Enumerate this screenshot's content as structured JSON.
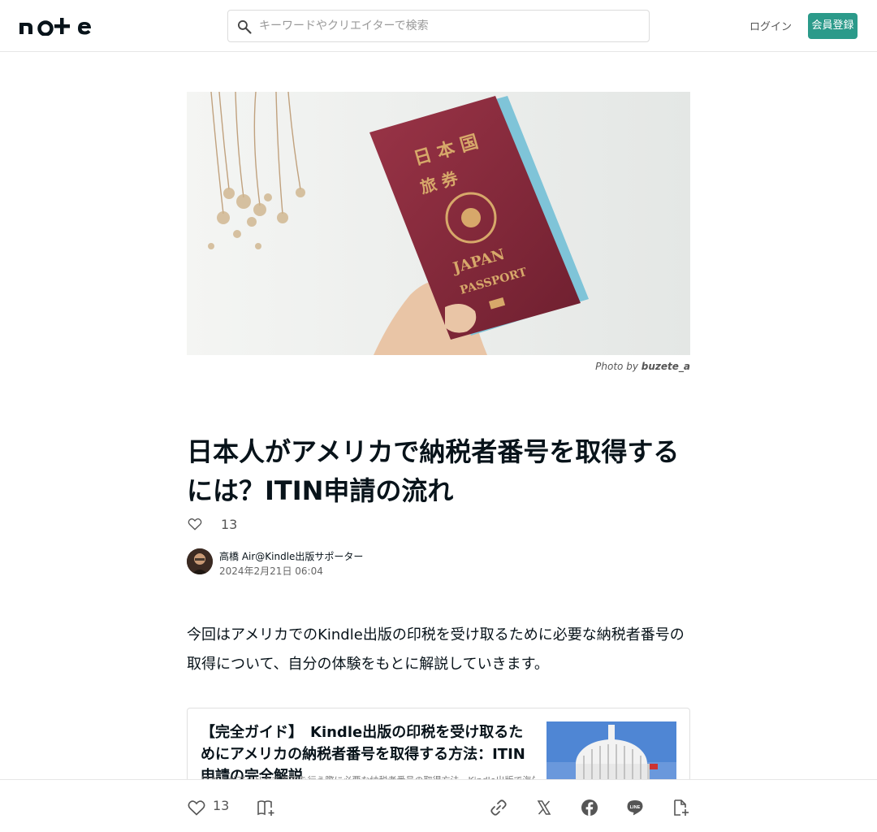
{
  "header": {
    "logo_icon": "note-logo",
    "search": {
      "placeholder": "キーワードやクリエイターで検索",
      "icon": "search-icon"
    },
    "login_label": "ログイン",
    "signup_label": "会員登録",
    "accent_color": "#2b9a8a"
  },
  "hero": {
    "image": "japan-passport-photo",
    "credit_prefix": "Photo by",
    "credit_name": "buzete_a"
  },
  "article": {
    "title": "日本人がアメリカで納税者番号を取得するには？ITIN申請の流れ",
    "likes": "13",
    "author_name": "高橋 Air@Kindle出版サポーター",
    "date": "2024年2月21日 06:04",
    "intro": "今回はアメリカでのKindle出版の印税を受け取るために必要な納税者番号の取得について、自分の体験をもとに解説していきます。"
  },
  "embed_card": {
    "title": "【完全ガイド】　Kindle出版の印税を受け取るためにアメリカの納税者番号を取得する方法：ITIN申請の完全解説",
    "description": "日本人がアメリカで事業を行う際に必要な納税者番号の取得方法。Kindle出版で海外から印税を受け取るための手続きについて",
    "thumb": "us-capitol-image"
  },
  "bottom_bar": {
    "like_count": "13",
    "icons": [
      "heart-icon",
      "magazine-add-icon",
      "link-icon",
      "x-icon",
      "facebook-icon",
      "line-icon",
      "embed-icon"
    ]
  }
}
